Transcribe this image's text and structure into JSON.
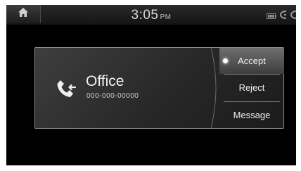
{
  "status_bar": {
    "home_icon": "home-icon",
    "time": "3:05",
    "ampm": "PM",
    "icons": [
      "battery-icon",
      "signal-icon",
      "call-icon"
    ]
  },
  "call": {
    "caller_name": "Office",
    "caller_number": "000-000-00000",
    "icon": "incoming-call-icon"
  },
  "actions": {
    "accept_label": "Accept",
    "reject_label": "Reject",
    "message_label": "Message"
  }
}
